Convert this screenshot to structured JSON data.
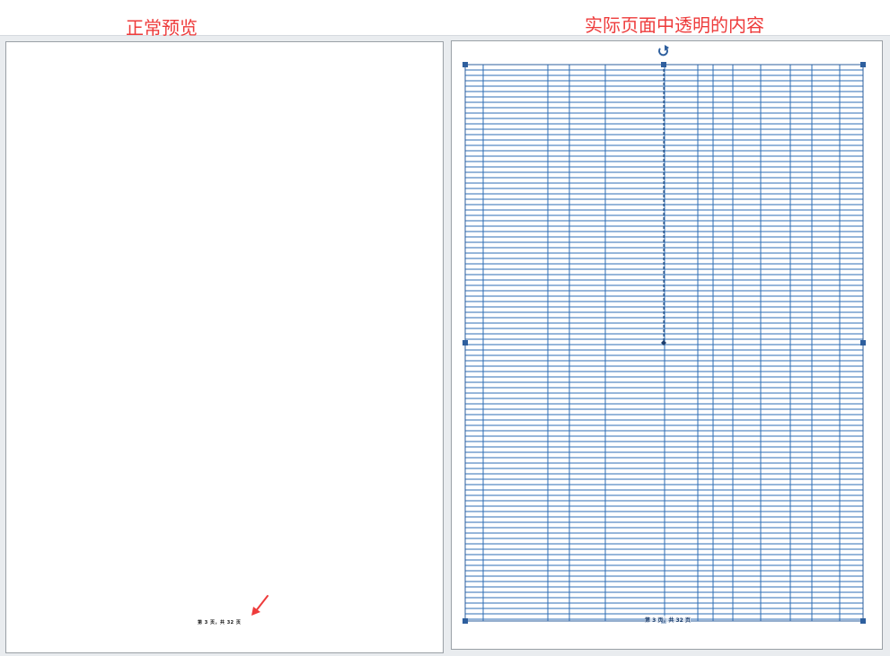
{
  "captions": {
    "normal_preview": "正常预览",
    "transparent_content": "实际页面中透明的内容"
  },
  "left_page": {
    "footer": "第 3 页，共 32 页"
  },
  "right_page": {
    "footer": "第 3 页，共 32 页"
  },
  "colors": {
    "caption": "#ee3b3b",
    "grid_line": "#2e6db4",
    "handle": "#2e5f9e",
    "arrow": "#ee3b3b"
  },
  "icons": {
    "rotate_handle": "rotate-icon",
    "pointer": "red-arrow-icon"
  }
}
